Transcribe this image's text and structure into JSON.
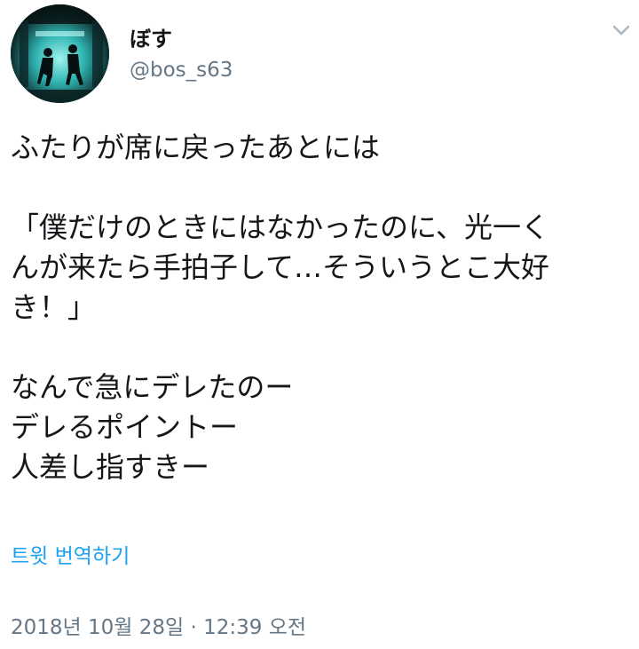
{
  "user": {
    "display_name": "ぼす",
    "handle": "@bos_s63"
  },
  "icons": {
    "menu": "chevron-down-icon"
  },
  "tweet": {
    "lines": [
      "ふたりが席に戻ったあとには",
      "",
      "「僕だけのときにはなかったのに、光一く",
      "んが来たら手拍子して…そういうとこ大好",
      "き！」",
      "",
      "なんで急にデレたのー",
      "デレるポイントー",
      "人差し指すきー"
    ]
  },
  "translate_label": "트윗 번역하기",
  "timestamp": "2018년 10월 28일 · 12:39 오전",
  "colors": {
    "text": "#14171a",
    "secondary": "#657786",
    "link": "#1da1f2"
  }
}
